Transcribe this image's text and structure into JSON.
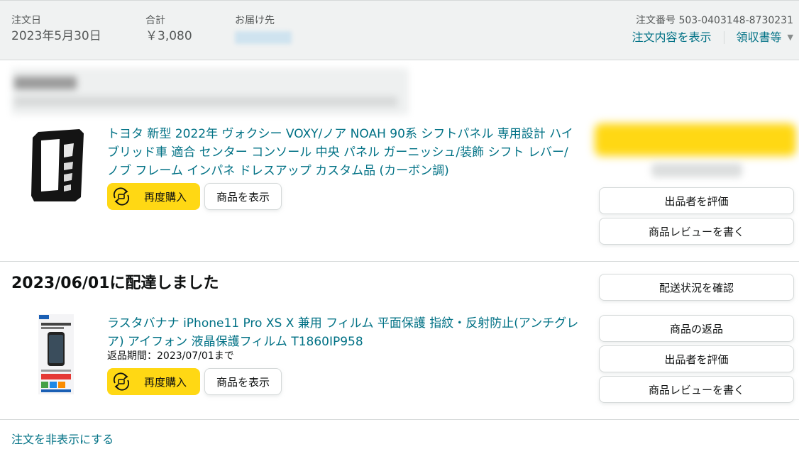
{
  "header": {
    "order_date_label": "注文日",
    "order_date": "2023年5月30日",
    "total_label": "合計",
    "total": "￥3,080",
    "ship_to_label": "お届け先",
    "order_number": "注文番号 503-0403148-8730231",
    "view_details": "注文内容を表示",
    "receipt": "領収書等"
  },
  "items": [
    {
      "title": "トヨタ 新型 2022年 ヴォクシー VOXY/ノア NOAH 90系 シフトパネル 専用設計 ハイブリッド車 適合 センター コンソール 中央 パネル ガーニッシュ/装飾 シフト レバー/ノブ フレーム インパネ ドレスアップ カスタム品 (カーボン調)",
      "buy_again": "再度購入",
      "view_item": "商品を表示",
      "side_buttons": [
        "出品者を評価",
        "商品レビューを書く"
      ]
    },
    {
      "delivery_status": "2023/06/01に配達しました",
      "title": "ラスタバナナ iPhone11 Pro XS X 兼用 フィルム 平面保護 指紋・反射防止(アンチグレア) アイフォン 液晶保護フィルム T1860IP958",
      "return_window": "返品期間：2023/07/01まで",
      "buy_again": "再度購入",
      "view_item": "商品を表示",
      "side_buttons": [
        "配送状況を確認",
        "商品の返品",
        "出品者を評価",
        "商品レビューを書く"
      ]
    }
  ],
  "hide_order": "注文を非表示にする",
  "colors": {
    "link": "#007185",
    "buy_button": "#ffd814",
    "header_bg": "#f0f2f2"
  }
}
